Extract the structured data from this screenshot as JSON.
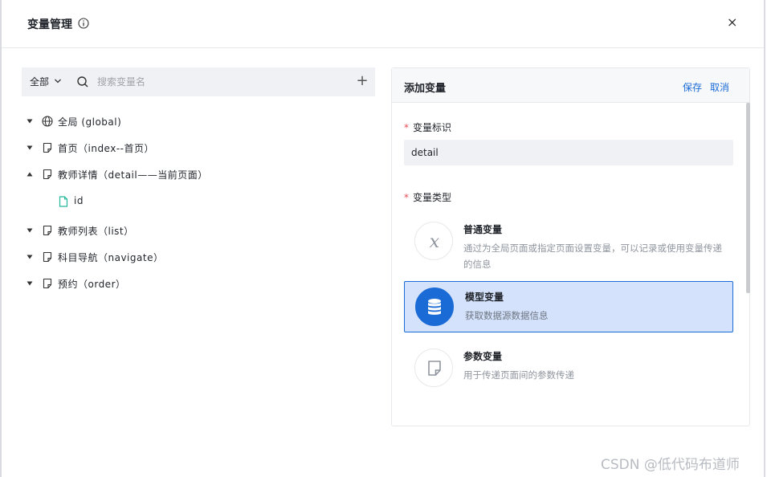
{
  "dialog": {
    "title": "变量管理",
    "close_glyph": "×"
  },
  "left": {
    "scope_label": "全部",
    "search_placeholder": "搜索变量名",
    "add_glyph": "+",
    "tree": [
      {
        "label": "全局 (global)",
        "icon": "globe-icon",
        "expanded": false
      },
      {
        "label": "首页（index--首页）",
        "icon": "page-icon",
        "expanded": false
      },
      {
        "label": "教师详情（detail——当前页面）",
        "icon": "page-icon",
        "expanded": true
      },
      {
        "label": "id",
        "icon": "file-icon",
        "child": true
      },
      {
        "label": "教师列表（list）",
        "icon": "page-icon",
        "expanded": false
      },
      {
        "label": "科目导航（navigate）",
        "icon": "page-icon",
        "expanded": false
      },
      {
        "label": "预约（order）",
        "icon": "page-icon",
        "expanded": false
      }
    ]
  },
  "right": {
    "title": "添加变量",
    "save_label": "保存",
    "cancel_label": "取消",
    "id_label": "变量标识",
    "id_value": "detail",
    "required_mark": "*",
    "type_label": "变量类型",
    "types": [
      {
        "name": "普通变量",
        "desc": "通过为全局页面或指定页面设置变量，可以记录或使用变量传递的信息",
        "icon": "variable-x-icon",
        "selected": false
      },
      {
        "name": "模型变量",
        "desc": "获取数据源数据信息",
        "icon": "database-icon",
        "selected": true
      },
      {
        "name": "参数变量",
        "desc": "用于传递页面间的参数传递",
        "icon": "page-icon",
        "selected": false
      }
    ]
  },
  "watermark": "CSDN @低代码布道师",
  "colors": {
    "accent": "#1b6bd7",
    "selected_bg": "#d4e3fb",
    "required": "#e34d59",
    "input_bg": "#f0f1f4"
  }
}
